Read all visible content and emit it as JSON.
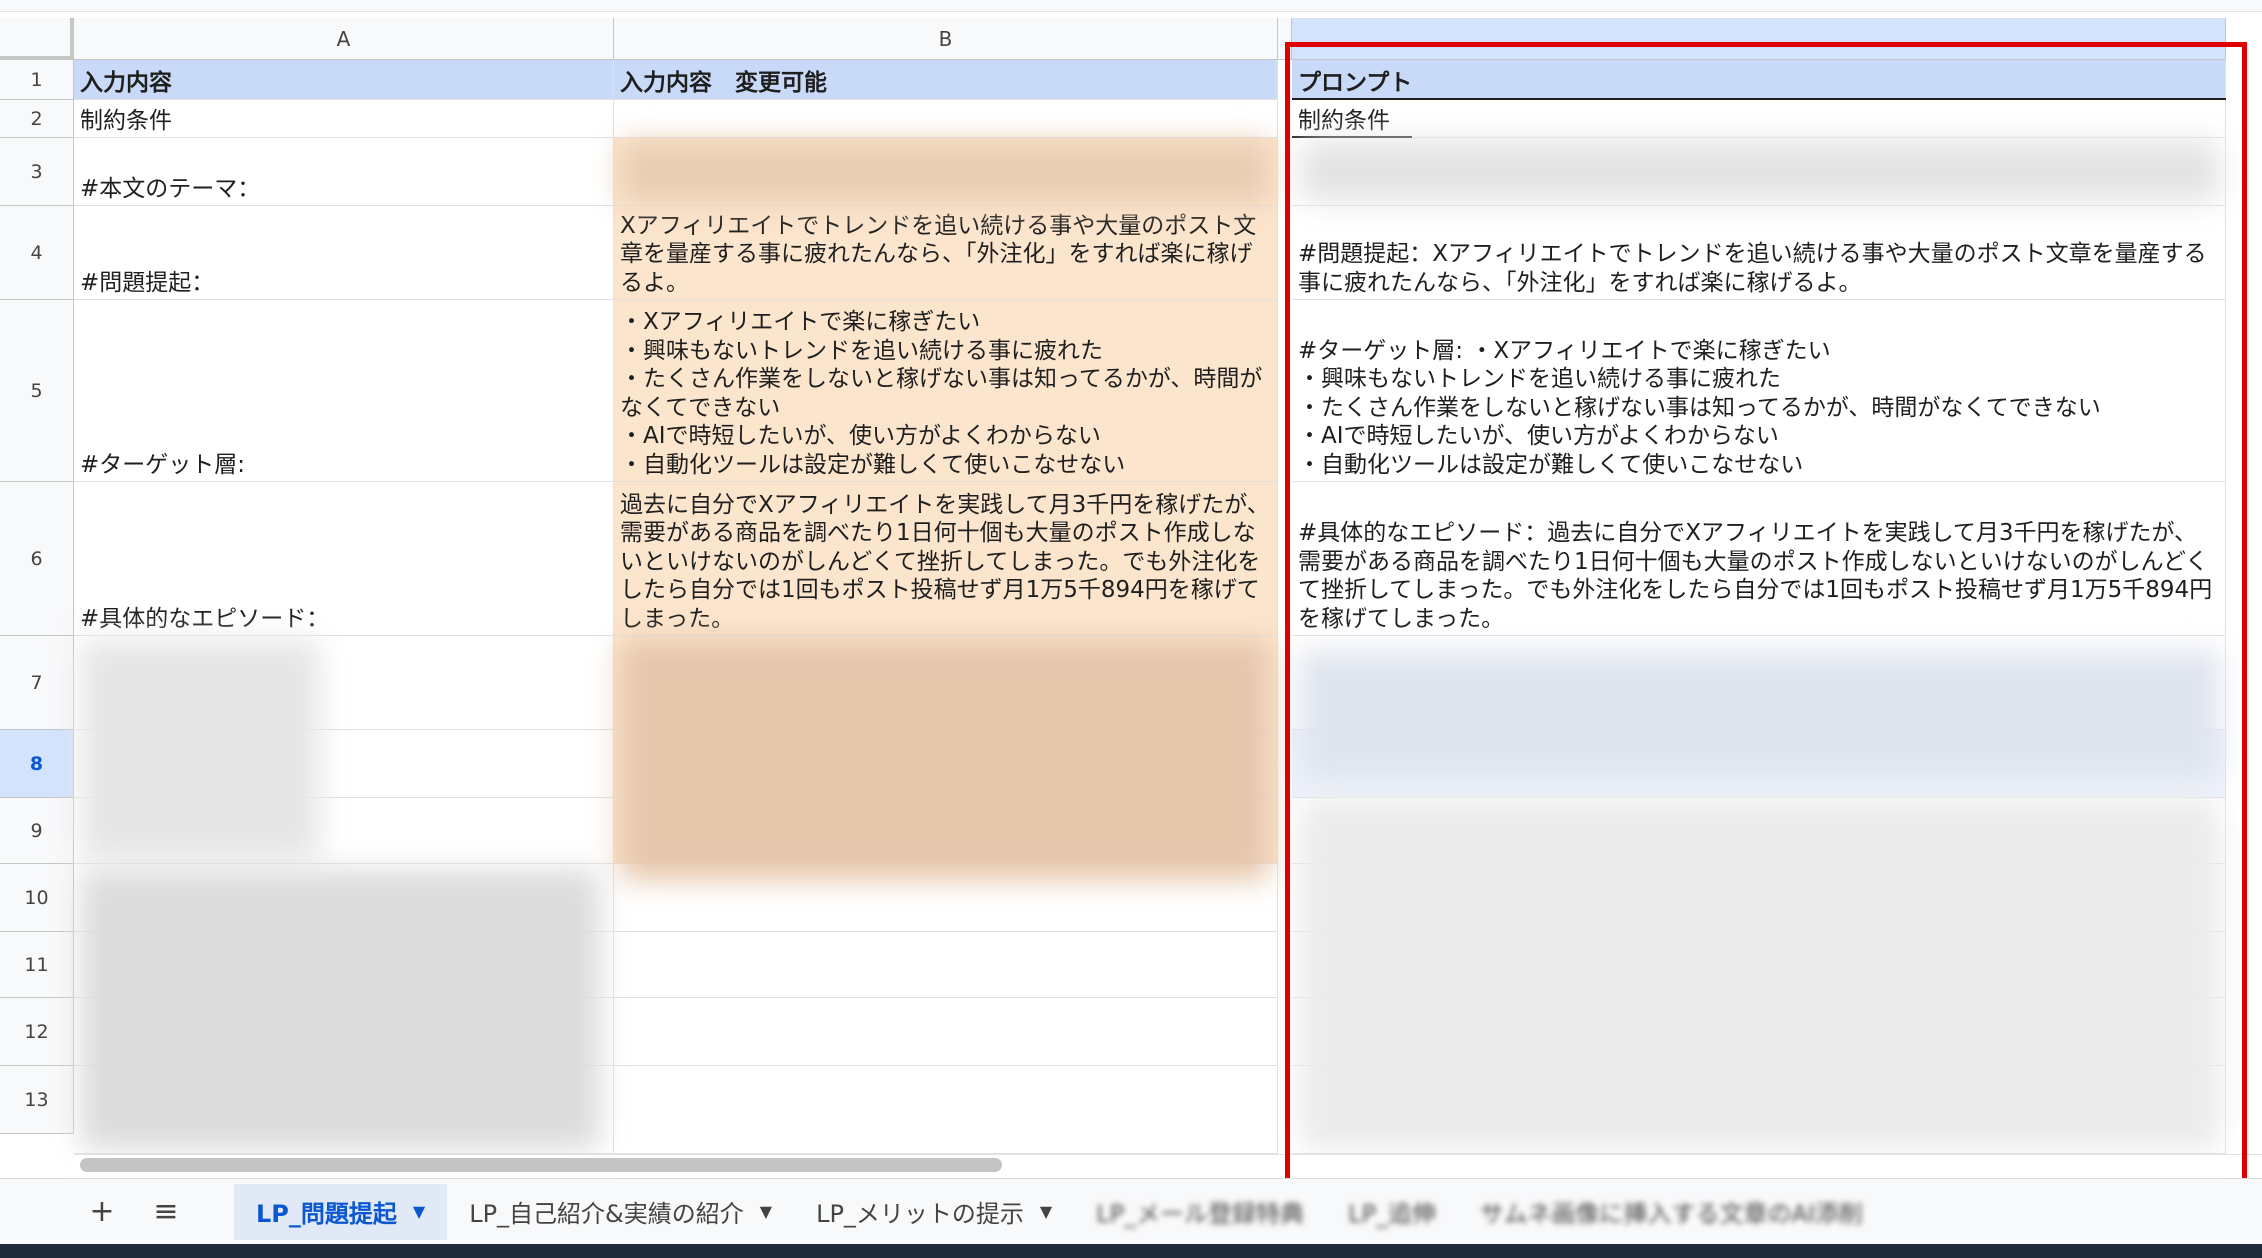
{
  "columns": [
    "A",
    "B",
    ""
  ],
  "rows": [
    "1",
    "2",
    "3",
    "4",
    "5",
    "6",
    "7",
    "8",
    "9",
    "10",
    "11",
    "12",
    "13"
  ],
  "cells": {
    "a1": "入力内容",
    "b1": "入力内容　変更可能",
    "c1": "プロンプト",
    "a2": "制約条件",
    "c2": "制約条件",
    "a3": "#本文のテーマ：",
    "a4": "#問題提起：",
    "b4": "Xアフィリエイトでトレンドを追い続ける事や大量のポスト文章を量産する事に疲れたんなら、「外注化」をすれば楽に稼げるよ。",
    "c4": "#問題提起：Xアフィリエイトでトレンドを追い続ける事や大量のポスト文章を量産する事に疲れたんなら、「外注化」をすれば楽に稼げるよ。",
    "a5": "#ターゲット層:",
    "b5": "・Xアフィリエイトで楽に稼ぎたい\n・興味もないトレンドを追い続ける事に疲れた\n・たくさん作業をしないと稼げない事は知ってるかが、時間がなくてできない\n・AIで時短したいが、使い方がよくわからない\n・自動化ツールは設定が難しくて使いこなせない",
    "c5": "#ターゲット層: ・Xアフィリエイトで楽に稼ぎたい\n・興味もないトレンドを追い続ける事に疲れた\n・たくさん作業をしないと稼げない事は知ってるかが、時間がなくてできない\n・AIで時短したいが、使い方がよくわからない\n・自動化ツールは設定が難しくて使いこなせない",
    "a6": "#具体的なエピソード：",
    "b6": "過去に自分でXアフィリエイトを実践して月3千円を稼げたが、需要がある商品を調べたり1日何十個も大量のポスト作成しないといけないのがしんどくて挫折してしまった。でも外注化をしたら自分では1回もポスト投稿せず月1万5千894円を稼げてしまった。",
    "c6": "#具体的なエピソード：過去に自分でXアフィリエイトを実践して月3千円を稼げたが、需要がある商品を調べたり1日何十個も大量のポスト作成しないといけないのがしんどくて挫折してしまった。でも外注化をしたら自分では1回もポスト投稿せず月1万5千894円を稼げてしまった。"
  },
  "tabs": [
    {
      "label": "LP_問題提起",
      "active": true
    },
    {
      "label": "LP_自己紹介&実績の紹介",
      "active": false
    },
    {
      "label": "LP_メリットの提示",
      "active": false
    },
    {
      "label": "LP_メール登録特典",
      "active": false
    },
    {
      "label": "LP_追伸",
      "active": false
    },
    {
      "label": "サムネ画像に挿入する文章のAI添削",
      "active": false
    }
  ],
  "colors": {
    "header_fill": "#c9daf8",
    "editable_fill": "#fce5cd",
    "highlight_box": "#e00000",
    "active_tab": "#0b57d0"
  }
}
